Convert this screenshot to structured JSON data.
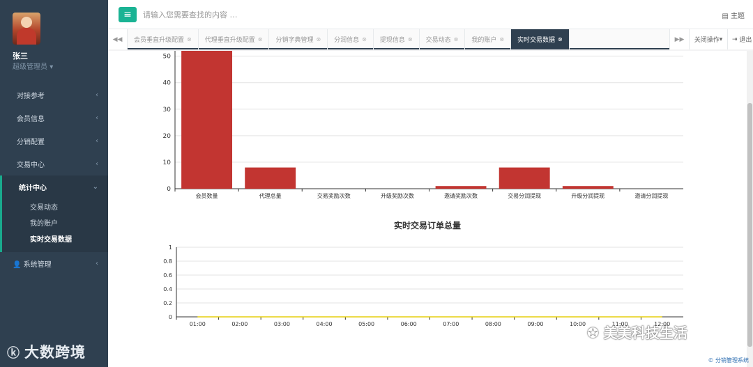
{
  "user": {
    "name": "张三",
    "role": "超级管理员"
  },
  "nav": [
    {
      "label": "对接参考"
    },
    {
      "label": "会员信息"
    },
    {
      "label": "分销配置"
    },
    {
      "label": "交易中心"
    }
  ],
  "nav_active": {
    "label": "统计中心",
    "children": [
      {
        "label": "交易动态"
      },
      {
        "label": "我的账户"
      },
      {
        "label": "实时交易数据"
      }
    ]
  },
  "nav_system": {
    "label": "系统管理"
  },
  "topbar": {
    "search_placeholder": "请输入您需要查找的内容 …",
    "theme": "主题"
  },
  "tabs": [
    {
      "label": "会员垂直升级配置"
    },
    {
      "label": "代理垂直升级配置"
    },
    {
      "label": "分销字典管理"
    },
    {
      "label": "分润信息"
    },
    {
      "label": "提现信息"
    },
    {
      "label": "交易动态"
    },
    {
      "label": "我的账户"
    },
    {
      "label": "实时交易数据"
    }
  ],
  "tab_ops": {
    "close_ops": "关闭操作",
    "exit": "退出"
  },
  "watermark": {
    "left": "大数跨境",
    "right": "美美科技生活"
  },
  "footer": {
    "note": "© 分销管理系统"
  },
  "colors": {
    "bar": "#c23531",
    "accent": "#1ab394",
    "sidebar": "#2f4050",
    "line": "#e5cf0d"
  },
  "chart_data": [
    {
      "type": "bar",
      "categories": [
        "会员数量",
        "代理总量",
        "交易奖励次数",
        "升级奖励次数",
        "邀请奖励次数",
        "交易分润提现",
        "升级分润提现",
        "邀请分润提现"
      ],
      "values": [
        52,
        8,
        0,
        0,
        1,
        8,
        1,
        0
      ],
      "y_ticks": [
        0,
        10,
        20,
        30,
        40,
        50
      ],
      "ylim": [
        0,
        52
      ]
    },
    {
      "type": "line",
      "title": "实时交易订单总量",
      "x": [
        "01:00",
        "02:00",
        "03:00",
        "04:00",
        "05:00",
        "06:00",
        "07:00",
        "08:00",
        "09:00",
        "10:00",
        "11:00",
        "12:00"
      ],
      "values": [
        0,
        0,
        0,
        0,
        0,
        0,
        0,
        0,
        0,
        0,
        0,
        0
      ],
      "y_ticks": [
        "0",
        "0.2",
        "0.4",
        "0.6",
        "0.8",
        "1"
      ],
      "ylim": [
        0,
        1
      ]
    }
  ]
}
